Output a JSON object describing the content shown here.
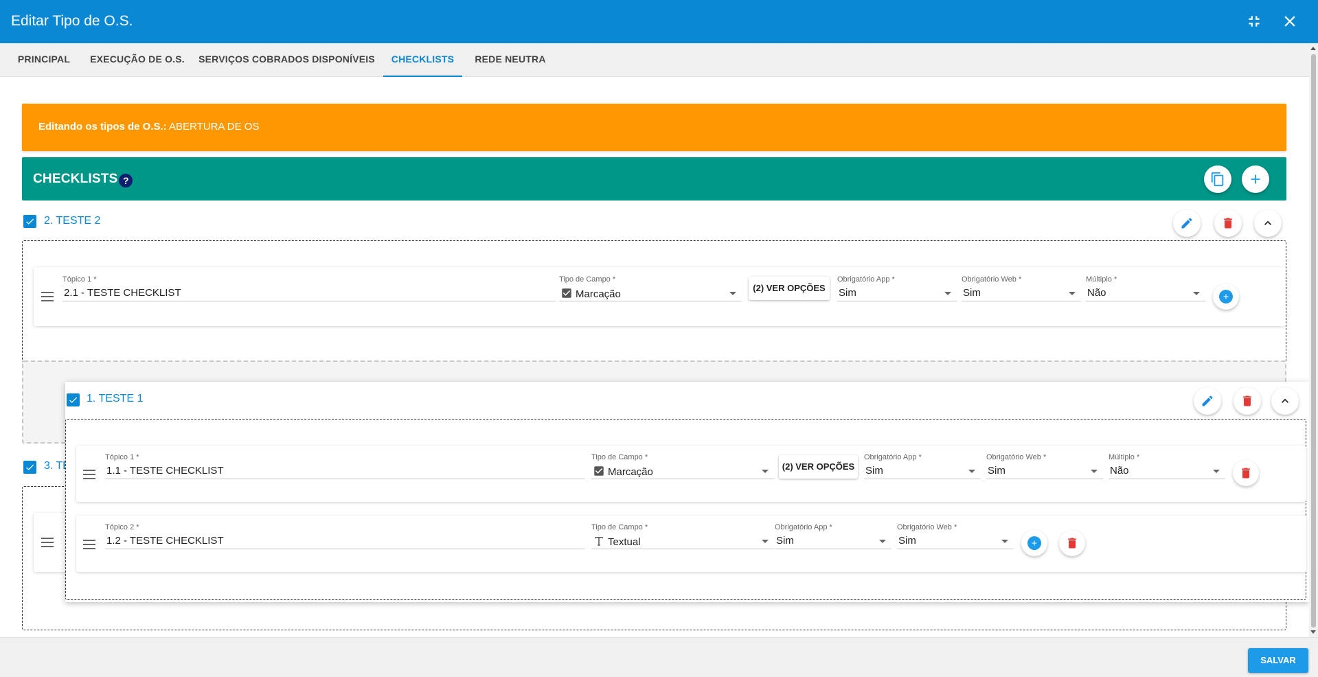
{
  "window": {
    "title": "Editar Tipo de O.S.",
    "minimize_icon": "compress-icon",
    "close_icon": "close-icon",
    "accent_color": "#0a88d4"
  },
  "tabs": [
    {
      "label": "PRINCIPAL",
      "active": false
    },
    {
      "label": "EXECUÇÃO DE O.S.",
      "active": false
    },
    {
      "label": "SERVIÇOS COBRADOS DISPONÍVEIS",
      "active": false
    },
    {
      "label": "CHECKLISTS",
      "active": true
    },
    {
      "label": "REDE NEUTRA",
      "active": false
    }
  ],
  "banner": {
    "prefix": "Editando os tipos de O.S.:",
    "value": "ABERTURA DE OS",
    "color": "#ff9800"
  },
  "checklists_header": {
    "title": "CHECKLISTS",
    "help": "?",
    "color": "#009688",
    "copy_icon": "copy-icon",
    "add_icon": "plus-icon"
  },
  "groups": [
    {
      "title": "2. TESTE 2",
      "checked": true,
      "topics": [
        {
          "topic_label": "Tópico 1 *",
          "topic_value": "2.1 - TESTE CHECKLIST",
          "field_type_label": "Tipo de Campo *",
          "field_type_value": "Marcação",
          "options_button": "(2) VER OPÇÕES",
          "app_label": "Obrigatório App *",
          "app_value": "Sim",
          "web_label": "Obrigatório Web *",
          "web_value": "Sim",
          "multiple_label": "Múltiplo *",
          "multiple_value": "Não"
        }
      ]
    },
    {
      "title": "1. TESTE 1",
      "checked": true,
      "dragging": true,
      "topics": [
        {
          "topic_label": "Tópico 1 *",
          "topic_value": "1.1 - TESTE CHECKLIST",
          "field_type_label": "Tipo de Campo *",
          "field_type_value": "Marcação",
          "options_button": "(2) VER OPÇÕES",
          "app_label": "Obrigatório App *",
          "app_value": "Sim",
          "web_label": "Obrigatório Web *",
          "web_value": "Sim",
          "multiple_label": "Múltiplo *",
          "multiple_value": "Não"
        },
        {
          "topic_label": "Tópico 2 *",
          "topic_value": "1.2 - TESTE CHECKLIST",
          "field_type_label": "Tipo de Campo *",
          "field_type_value": "Textual",
          "app_label": "Obrigatório App *",
          "app_value": "Sim",
          "web_label": "Obrigatório Web *",
          "web_value": "Sim"
        }
      ]
    },
    {
      "title_partial": "3. TE",
      "checked": true
    }
  ],
  "footer": {
    "save_label": "SALVAR"
  },
  "colors": {
    "edit": "#1e88e5",
    "delete": "#e53935",
    "add": "#1e9be8"
  }
}
